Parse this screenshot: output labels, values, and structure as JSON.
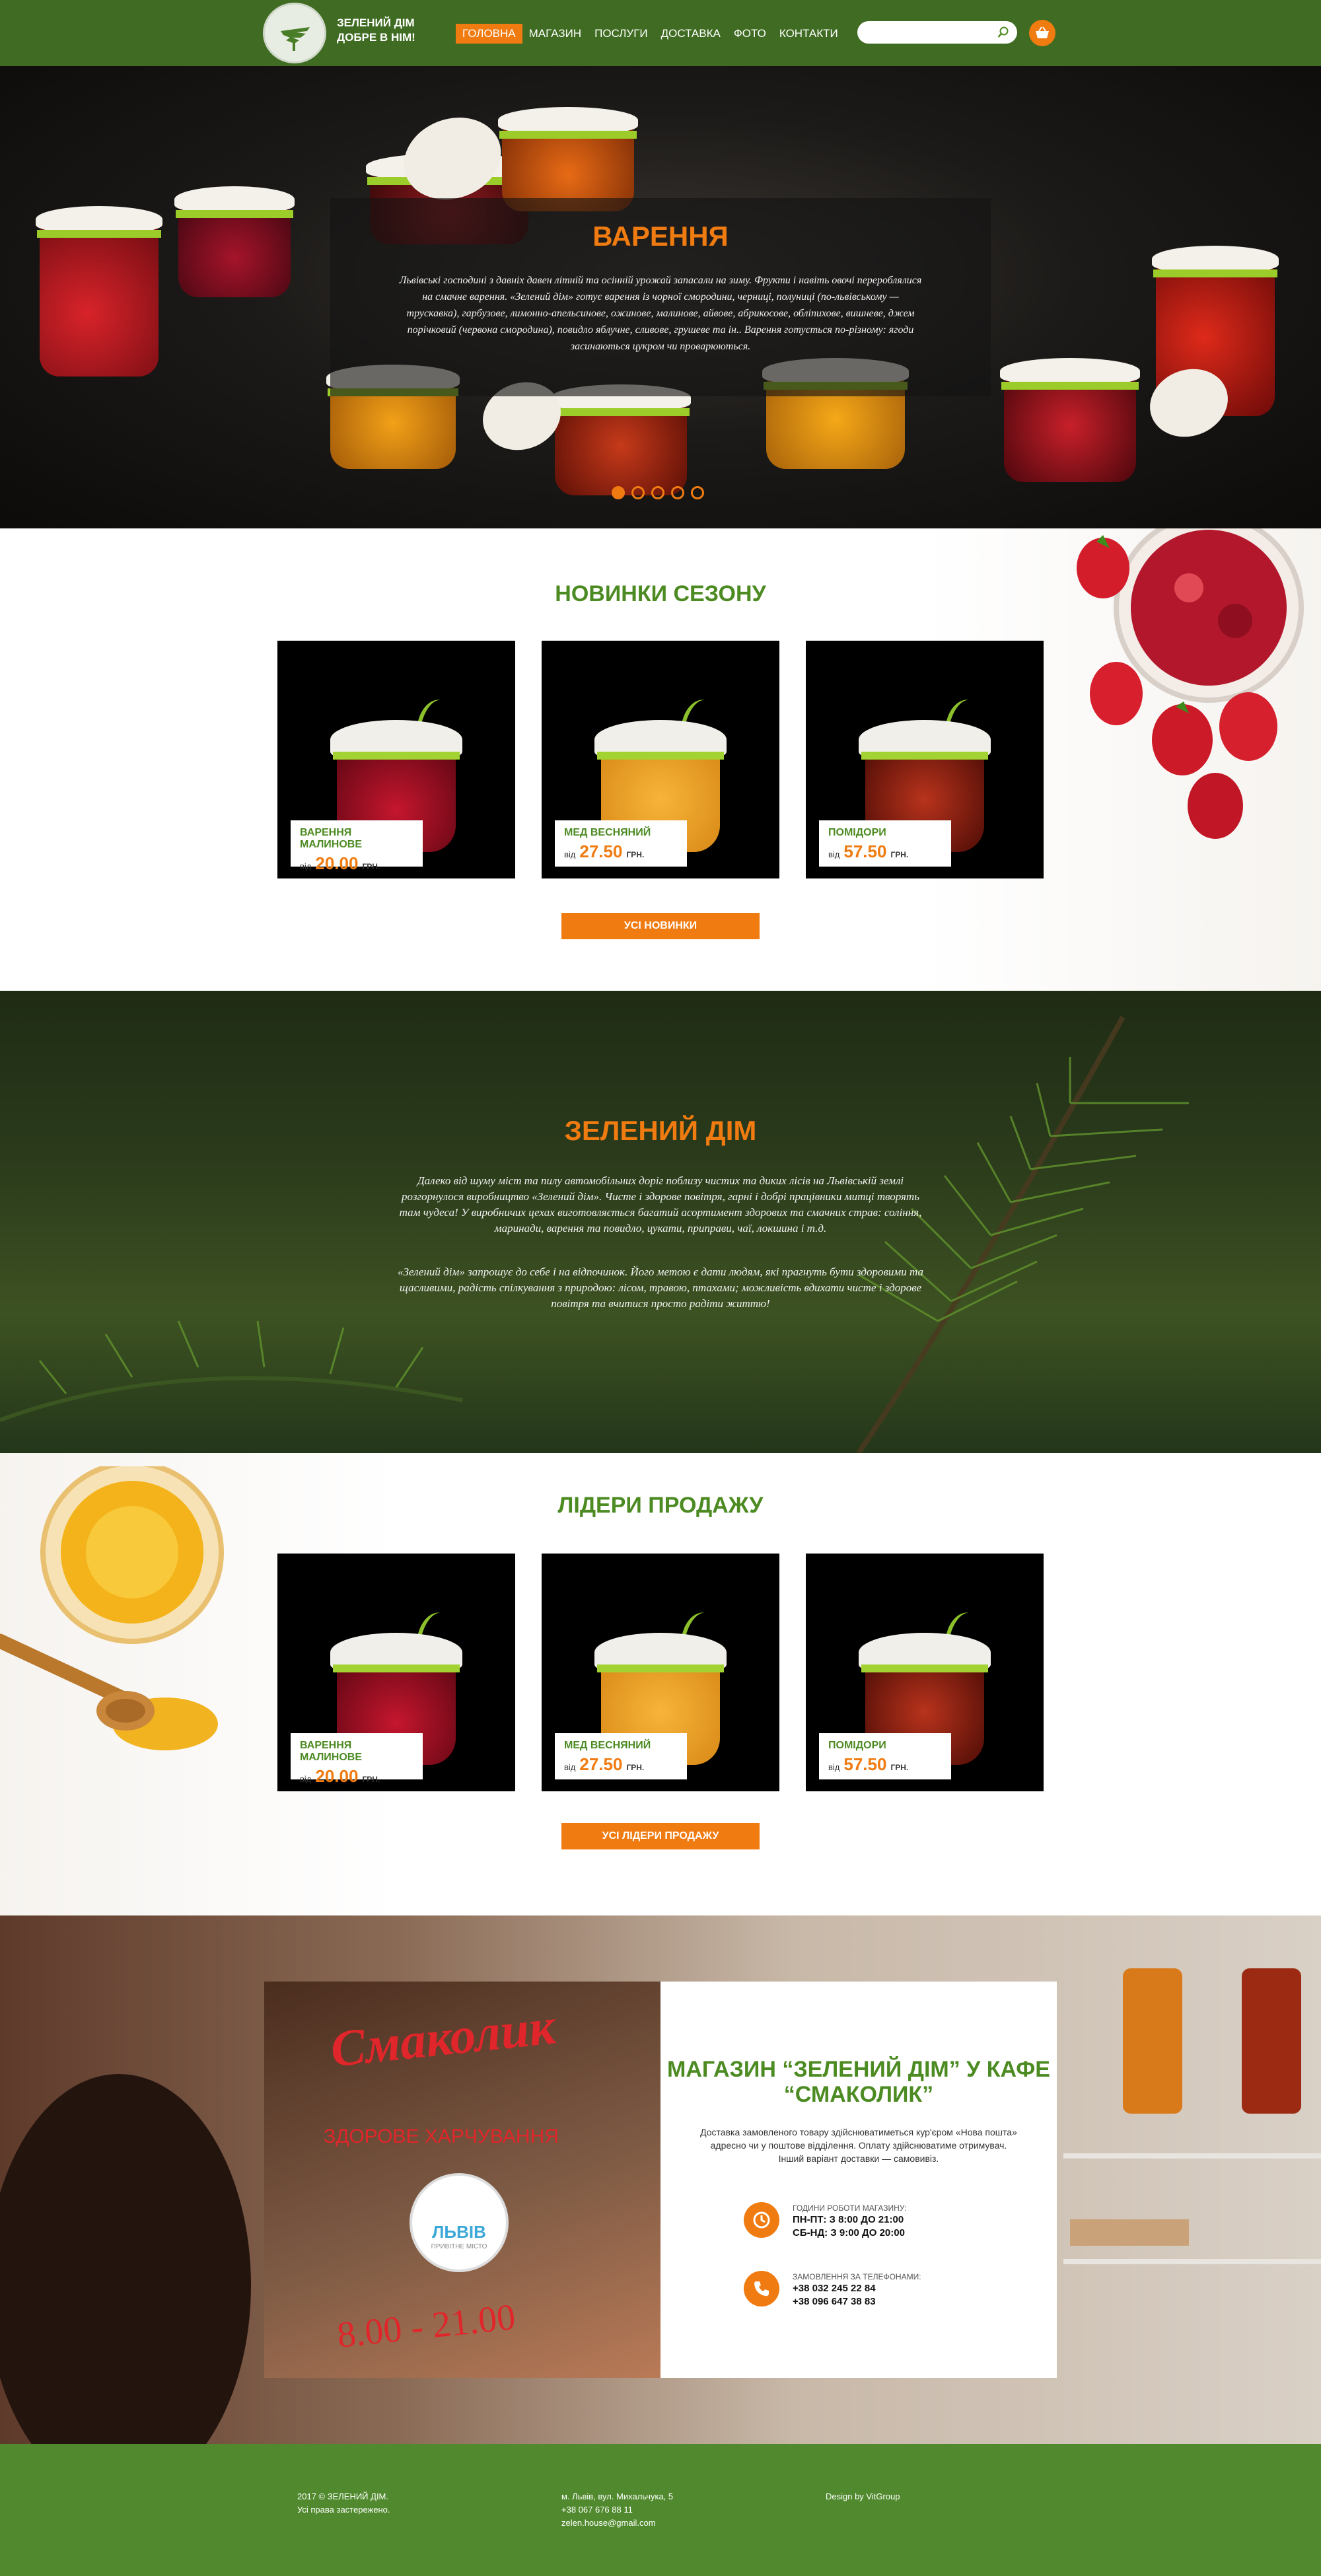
{
  "header": {
    "logo_line1": "ЗЕЛЕНИЙ ДІМ",
    "logo_line2": "ДОБРЕ В НІМ!",
    "nav": [
      "ГОЛОВНА",
      "МАГАЗИН",
      "ПОСЛУГИ",
      "ДОСТАВКА",
      "ФОТО",
      "КОНТАКТИ"
    ],
    "active_nav": "ГОЛОВНА",
    "search_placeholder": ""
  },
  "hero": {
    "title": "ВАРЕННЯ",
    "text": "Львівські господині з давніх давен літній та осінній урожай запасали на зиму. Фрукти і навіть овочі перероблялися на смачне варення. «Зелений дім» готує варення із чорної смородини, черниці, полуниці (по-львівському — трускавка), гарбузове, лимонно-апельсинове, ожинове, малинове, айвове, абрикосове, обліпихове, вишневе, джем порічковий (червона смородина), повидло яблучне, сливове, грушеве та ін.. Варення готується по-різному: ягоди засинаються цукром чи проварюються.",
    "slides": 5,
    "active_slide": 1
  },
  "new_season": {
    "title": "НОВИНКИ СЕЗОНУ",
    "button": "УСІ НОВИНКИ",
    "items": [
      {
        "name": "ВАРЕННЯ МАЛИНОВЕ",
        "from": "від",
        "price": "20.00",
        "currency": "ГРН."
      },
      {
        "name": "МЕД ВЕСНЯНИЙ",
        "from": "від",
        "price": "27.50",
        "currency": "ГРН."
      },
      {
        "name": "ПОМІДОРИ",
        "from": "від",
        "price": "57.50",
        "currency": "ГРН."
      }
    ]
  },
  "about": {
    "title": "ЗЕЛЕНИЙ ДІМ",
    "para1": "Далеко від шуму міст та пилу автомобільних доріг поблизу чистих та диких лісів на Львівській землі розгорнулося виробництво «Зелений дім». Чисте і здорове повітря, гарні і добрі працівники митці творять там чудеса! У виробничих цехах виготовляється багатий асортимент здорових та смачних страв: соління, маринади, варення та повидло, цукати, приправи, чаї, локшина і т.д.",
    "para2": "«Зелений дім» запрошує до себе і на відпочинок. Його метою є дати людям, які прагнуть бути здоровими та щасливими, радість спілкування з природою: лісом, травою, птахами; можливість вдихати чисте і здорове повітря та вчитися просто радіти життю!"
  },
  "bestsellers": {
    "title": "ЛІДЕРИ ПРОДАЖУ",
    "button": "УСІ ЛІДЕРИ ПРОДАЖУ",
    "items": [
      {
        "name": "ВАРЕННЯ МАЛИНОВЕ",
        "from": "від",
        "price": "20.00",
        "currency": "ГРН."
      },
      {
        "name": "МЕД ВЕСНЯНИЙ",
        "from": "від",
        "price": "27.50",
        "currency": "ГРН."
      },
      {
        "name": "ПОМІДОРИ",
        "from": "від",
        "price": "57.50",
        "currency": "ГРН."
      }
    ]
  },
  "shop": {
    "cafe_brand": "Смаколик",
    "cafe_slogan": "ЗДОРОВЕ ХАРЧУВАННЯ",
    "city_badge": "ЛЬВІВ",
    "city_badge_sub": "ПРИВІТНЕ МІСТО",
    "cafe_hours": "8.00 - 21.00",
    "title": "МАГАЗИН “ЗЕЛЕНИЙ ДІМ” У КАФЕ “СМАКОЛИК”",
    "desc1": "Доставка замовленого товару здійснюватиметься кур'єром «Нова пошта» адресно чи у поштове відділення. Оплату здійснюватиме отримувач.",
    "desc2": "Інший варіант доставки — самовивіз.",
    "hours_label": "ГОДИНИ РОБОТИ МАГАЗИНУ:",
    "hours_1": "ПН-ПТ: З 8:00 ДО 21:00",
    "hours_2": "СБ-НД: З 9:00 ДО 20:00",
    "phone_label": "ЗАМОВЛЕННЯ ЗА ТЕЛЕФОНАМИ:",
    "phone_1": "+38 032 245 22 84",
    "phone_2": "+38 096 647 38 83"
  },
  "footer": {
    "copyright": "2017 © ЗЕЛЕНИЙ ДІМ.",
    "rights": "Усі права застережено.",
    "address": "м. Львів, вул. Михальчука, 5",
    "phone": "+38 067 676 88 11",
    "email": "zelen.house@gmail.com",
    "design": "Design by VitGroup"
  },
  "colors": {
    "green_dark": "#3f6c22",
    "green_text": "#4c8a22",
    "orange": "#f07b10",
    "footer_green": "#518a2e"
  }
}
